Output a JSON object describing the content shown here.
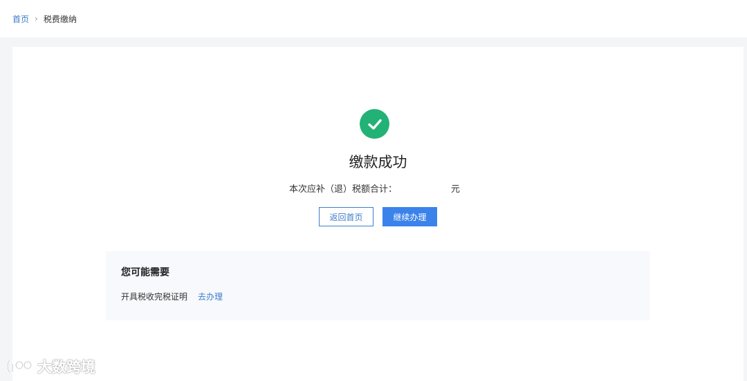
{
  "breadcrumb": {
    "home": "首页",
    "separator": "›",
    "current": "税费缴纳"
  },
  "result": {
    "icon": "check-circle-icon",
    "title": "缴款成功",
    "amount_label": "本次应补（退）税额合计：",
    "amount_value": "",
    "amount_unit": "元"
  },
  "buttons": {
    "home_label": "返回首页",
    "continue_label": "继续办理"
  },
  "suggestions": {
    "title": "您可能需要",
    "items": [
      {
        "label": "开具税收完税证明",
        "action": "去办理"
      }
    ]
  },
  "watermark": {
    "text": "大数跨境"
  },
  "colors": {
    "success": "#23b276",
    "primary": "#3b82ea",
    "link": "#3f7cc8",
    "page_bg": "#f4f5f7"
  }
}
